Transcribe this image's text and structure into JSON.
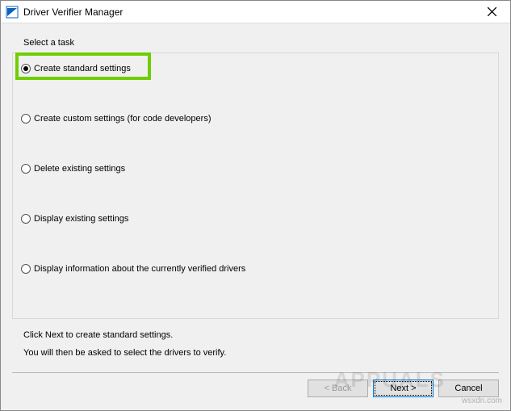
{
  "titlebar": {
    "title": "Driver Verifier Manager"
  },
  "prompt": "Select a task",
  "options": [
    {
      "label": "Create standard settings",
      "selected": true
    },
    {
      "label": "Create custom settings (for code developers)",
      "selected": false
    },
    {
      "label": "Delete existing settings",
      "selected": false
    },
    {
      "label": "Display existing settings",
      "selected": false
    },
    {
      "label": "Display information about the currently verified drivers",
      "selected": false
    }
  ],
  "hint1": "Click Next to create standard settings.",
  "hint2": "You will then be asked to select the drivers to verify.",
  "buttons": {
    "back": "< Back",
    "next": "Next >",
    "cancel": "Cancel"
  },
  "watermark_logo": "APPUALS",
  "watermark": "wsxdn.com"
}
